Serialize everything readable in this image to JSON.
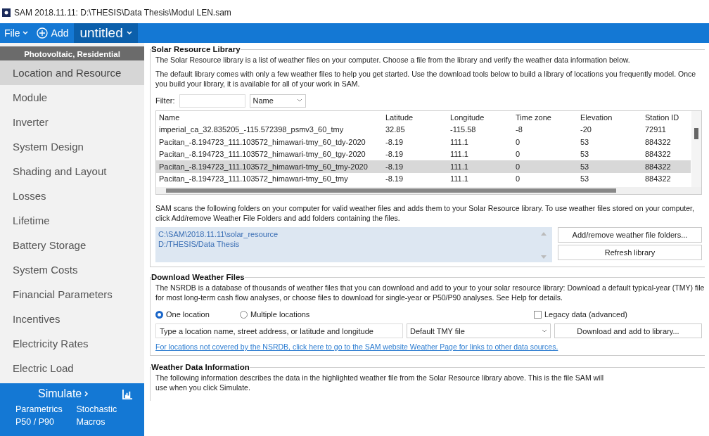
{
  "title_bar": {
    "title": "SAM 2018.11.11: D:\\THESIS\\Data Thesis\\Modul LEN.sam"
  },
  "menu_bar": {
    "file": "File",
    "add": "Add",
    "case_tab": "untitled"
  },
  "sidebar": {
    "header": "Photovoltaic, Residential",
    "items": [
      {
        "label": "Location and Resource",
        "selected": true
      },
      {
        "label": "Module",
        "selected": false
      },
      {
        "label": "Inverter",
        "selected": false
      },
      {
        "label": "System Design",
        "selected": false
      },
      {
        "label": "Shading and Layout",
        "selected": false
      },
      {
        "label": "Losses",
        "selected": false
      },
      {
        "label": "Lifetime",
        "selected": false
      },
      {
        "label": "Battery Storage",
        "selected": false
      },
      {
        "label": "System Costs",
        "selected": false
      },
      {
        "label": "Financial Parameters",
        "selected": false
      },
      {
        "label": "Incentives",
        "selected": false
      },
      {
        "label": "Electricity Rates",
        "selected": false
      },
      {
        "label": "Electric Load",
        "selected": false
      }
    ],
    "simulate": "Simulate",
    "links": [
      "Parametrics",
      "Stochastic",
      "P50 / P90",
      "Macros"
    ]
  },
  "solar_resource_library": {
    "title": "Solar Resource Library",
    "description": [
      "The Solar Resource library is a list of weather files on your computer. Choose a file from the library and verify the weather data information below.",
      "The default library comes with only a few weather files to help you get started. Use the download tools below to build a library of locations you frequently model. Once you build your library, it is available for all of your work in SAM."
    ],
    "filter": {
      "label": "Filter:",
      "field_by": "Name"
    },
    "table": {
      "columns": [
        "Name",
        "Latitude",
        "Longitude",
        "Time zone",
        "Elevation",
        "Station ID"
      ],
      "rows": [
        {
          "cells": [
            "imperial_ca_32.835205_-115.572398_psmv3_60_tmy",
            "32.85",
            "-115.58",
            "-8",
            "-20",
            "72911"
          ],
          "selected": false
        },
        {
          "cells": [
            "Pacitan_-8.194723_111.103572_himawari-tmy_60_tdy-2020",
            "-8.19",
            "111.1",
            "0",
            "53",
            "884322"
          ],
          "selected": false
        },
        {
          "cells": [
            "Pacitan_-8.194723_111.103572_himawari-tmy_60_tgy-2020",
            "-8.19",
            "111.1",
            "0",
            "53",
            "884322"
          ],
          "selected": false
        },
        {
          "cells": [
            "Pacitan_-8.194723_111.103572_himawari-tmy_60_tmy-2020",
            "-8.19",
            "111.1",
            "0",
            "53",
            "884322"
          ],
          "selected": true
        },
        {
          "cells": [
            "Pacitan_-8.194723_111.103572_himawari-tmy_60_tmy",
            "-8.19",
            "111.1",
            "0",
            "53",
            "884322"
          ],
          "selected": false
        }
      ]
    },
    "folders_note": "SAM scans the following folders on your computer for valid weather files and adds them to your Solar Resource library. To use weather files stored on your computer, click Add/remove Weather File Folders and add folders containing the files.",
    "folders": [
      "C:\\SAM\\2018.11.11\\solar_resource",
      "D:/THESIS/Data Thesis"
    ],
    "buttons": [
      "Add/remove weather file folders...",
      "Refresh library"
    ]
  },
  "download_weather_files": {
    "title": "Download Weather Files",
    "description": "The NSRDB is a database of thousands of weather files that you can download and add to your to your solar resource library: Download a default typical-year (TMY) file for most long-term cash flow analyses, or choose files to download for single-year or P50/P90 analyses. See Help for details.",
    "location_modes": [
      {
        "label": "One location",
        "selected": true
      },
      {
        "label": "Multiple locations",
        "selected": false
      }
    ],
    "legacy_data": {
      "label": "Legacy data (advanced)",
      "checked": false
    },
    "location_field": {
      "placeholder": "Type a location name, street address, or latitude and longitude"
    },
    "file_type": "Default TMY file",
    "download_button": "Download and add to library...",
    "link": "For locations not covered by the NSRDB, click here to go to the SAM website Weather Page for links to other data sources."
  },
  "weather_data_information": {
    "title": "Weather Data Information",
    "description": "The following information describes the data in the highlighted weather file from the Solar Resource library above. This is the file SAM will use when you click Simulate."
  }
}
